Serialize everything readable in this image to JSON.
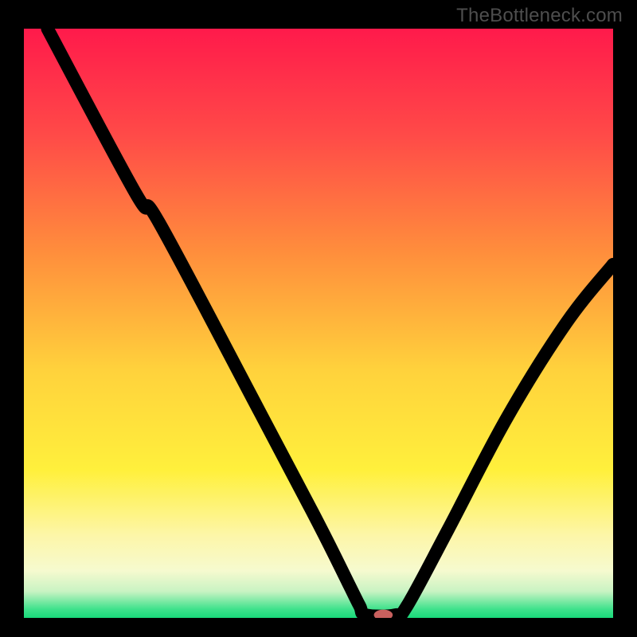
{
  "watermark": "TheBottleneck.com",
  "chart_data": {
    "type": "line",
    "title": "",
    "xlabel": "",
    "ylabel": "",
    "xlim": [
      0,
      100
    ],
    "ylim": [
      0,
      100
    ],
    "grid": false,
    "legend": false,
    "gradient_stops": [
      {
        "offset": 0,
        "color": "#ff1a4b"
      },
      {
        "offset": 0.18,
        "color": "#ff4a48"
      },
      {
        "offset": 0.38,
        "color": "#ff8e3c"
      },
      {
        "offset": 0.58,
        "color": "#ffd23c"
      },
      {
        "offset": 0.75,
        "color": "#fff03c"
      },
      {
        "offset": 0.86,
        "color": "#fdf6a8"
      },
      {
        "offset": 0.92,
        "color": "#f6facf"
      },
      {
        "offset": 0.955,
        "color": "#c9f3c3"
      },
      {
        "offset": 0.985,
        "color": "#3fe28c"
      },
      {
        "offset": 1.0,
        "color": "#19d97a"
      }
    ],
    "curve": [
      {
        "x": 4,
        "y": 100
      },
      {
        "x": 19,
        "y": 72
      },
      {
        "x": 23,
        "y": 67
      },
      {
        "x": 40,
        "y": 35
      },
      {
        "x": 50,
        "y": 16
      },
      {
        "x": 55,
        "y": 6
      },
      {
        "x": 57,
        "y": 2
      },
      {
        "x": 58,
        "y": 0.5
      },
      {
        "x": 63,
        "y": 0.5
      },
      {
        "x": 65,
        "y": 2
      },
      {
        "x": 72,
        "y": 15
      },
      {
        "x": 82,
        "y": 34
      },
      {
        "x": 92,
        "y": 50
      },
      {
        "x": 100,
        "y": 60
      }
    ],
    "marker": {
      "x": 61,
      "y": 0.5,
      "rx": 1.6,
      "ry": 0.9
    }
  }
}
